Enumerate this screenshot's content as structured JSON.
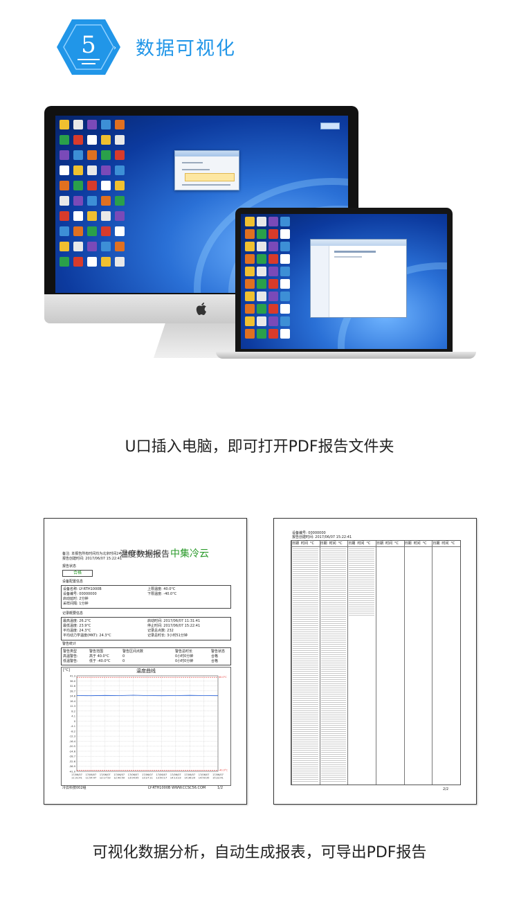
{
  "header": {
    "badge_number": "5",
    "title": "数据可视化"
  },
  "captions": {
    "desktop": "U口插入电脑，即可打开PDF报告文件夹",
    "reports": "可视化数据分析，自动生成报表，可导出PDF报告"
  },
  "colors": {
    "accent": "#2196e8",
    "brand_green": "#2a9a2a",
    "alarm_line": "#e53935",
    "data_line": "#1e5bd8"
  },
  "report": {
    "title": "温度数据报告",
    "brand": "中集冷云",
    "note": "备注: 本报告所有时间均为北京时间24小时制[年/月/日 时:分:秒]",
    "created": "报告创建时间:    2017/06/07  15:22:41",
    "status_heading": "报告状态",
    "status_value": "合格",
    "config_heading": "设备配置信息",
    "config": [
      [
        "设备名称:  LY-RTH1000B",
        "上限温度:  40.0°C"
      ],
      [
        "设备编号:  00000000",
        "下限温度:  -40.0°C"
      ],
      [
        "启动延时:  2分钟",
        ""
      ],
      [
        "采样间隔:  1分钟",
        ""
      ]
    ],
    "summary_heading": "记录概要信息",
    "summary": [
      [
        "最高温度:  26.2°C",
        "启动时间:  2017/06/07  11:31:41"
      ],
      [
        "最低温度:  23.9°C",
        "停止时间:  2017/06/07  15:22:41"
      ],
      [
        "平均温度:  24.3°C",
        "记录总点数:  232"
      ],
      [
        "平均动力学温度(MKT):  24.3°C",
        "记录总时长:  3小时51分钟"
      ]
    ],
    "alarm_heading": "警告统计",
    "alarm_columns": [
      "警告类型",
      "警告范围",
      "警告区间点数",
      "警告总时长",
      "警告状态"
    ],
    "alarm_rows": [
      [
        "高温警告:",
        "高于 40.0°C",
        "0",
        "0小时0分钟",
        "合格"
      ],
      [
        "低温警告:",
        "低于 -40.0°C",
        "0",
        "0小时0分钟",
        "合格"
      ]
    ],
    "footer_left": "冷云科技002组",
    "footer_mid": "LY-RTH1000B  WWW.CCSC56.COM",
    "footer_page": "1/2"
  },
  "chart_data": {
    "type": "line",
    "title": "温度曲线",
    "ylabel": "[°C]",
    "yticks": [
      "41.3",
      "36.0",
      "32.6",
      "28.7",
      "24.8",
      "16.4",
      "12.3",
      "8.2",
      "4.1",
      "0",
      "-4.1",
      "-8.2",
      "-12.3",
      "-16.4",
      "-20.5",
      "-24.6",
      "-28.7",
      "-32.6",
      "-36.9",
      "-41.0"
    ],
    "ylim": [
      -41.0,
      41.3
    ],
    "upper_limit": 40.0,
    "lower_limit": -40.0,
    "upper_label": "40.0°C",
    "lower_label": "-40.0°C",
    "x": [
      "17/06/07 11:31:41",
      "17/06/07 11:54:47",
      "17/06/07 12:17:53",
      "17/06/07 12:40:59",
      "17/06/07 13:04:05",
      "17/06/07 13:27:11",
      "17/06/07 13:50:17",
      "17/06/07 14:13:23",
      "17/06/07 14:36:29",
      "17/06/07 14:59:35",
      "17/06/07 15:22:41"
    ],
    "series": [
      {
        "values": [
          24.3,
          24.2,
          24.4,
          24.3,
          24.6,
          24.3,
          24.2,
          24.3,
          24.5,
          24.3,
          24.2
        ]
      }
    ]
  },
  "report_page2": {
    "device_no": "设备编号:    00000000",
    "created": "报告创建时间: 2017/06/07  15:22:41",
    "columns": [
      "日期",
      "时间",
      "°C"
    ],
    "page": "2/2"
  }
}
